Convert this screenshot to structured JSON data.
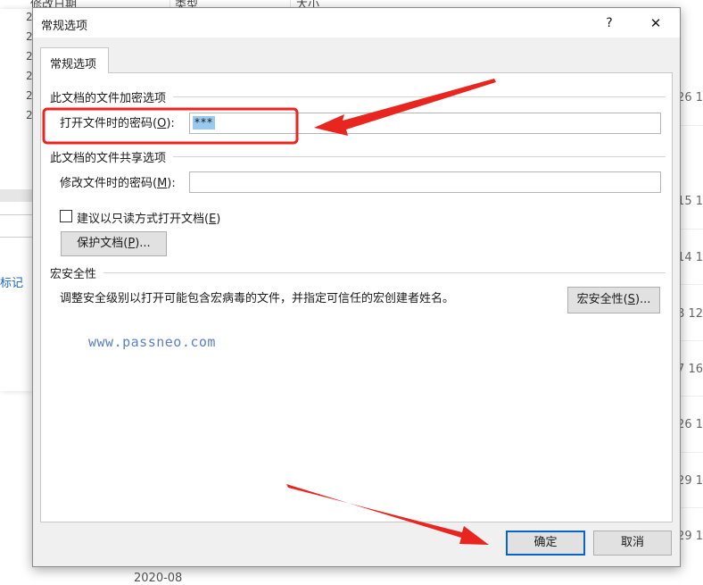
{
  "background": {
    "columns": [
      "修改日期",
      "类型",
      "大小"
    ],
    "side_label": "标记",
    "row_numbers": [
      "2",
      "2",
      "2",
      "2",
      "2",
      "2"
    ],
    "dates": [
      "/26 1",
      "/15 1",
      "/14 1",
      "/8 12",
      "/7 16",
      "/26 1",
      "/29 1",
      "/29 1"
    ],
    "bottom_text": "2020-08"
  },
  "dialog": {
    "title": "常规选项",
    "help_label": "?",
    "close_label": "✕",
    "tab_label": "常规选项",
    "encryption": {
      "section_label": "此文档的文件加密选项",
      "open_password_label": "打开文件时的密码(",
      "open_password_hotkey": "O",
      "open_password_suffix": "):",
      "open_password_value": "***"
    },
    "sharing": {
      "section_label": "此文档的文件共享选项",
      "modify_password_label": "修改文件时的密码(",
      "modify_password_hotkey": "M",
      "modify_password_suffix": "):",
      "modify_password_value": "",
      "readonly_label": "建议以只读方式打开文档(",
      "readonly_hotkey": "E",
      "readonly_suffix": ")",
      "readonly_checked": false,
      "protect_button_label": "保护文档(",
      "protect_button_hotkey": "P",
      "protect_button_suffix": ")..."
    },
    "macro": {
      "section_label": "宏安全性",
      "description": "调整安全级别以打开可能包含宏病毒的文件，并指定可信任的宏创建者姓名。",
      "button_label": "宏安全性(",
      "button_hotkey": "S",
      "button_suffix": ")..."
    },
    "watermark": "www.passneo.com",
    "ok_label": "确定",
    "cancel_label": "取消"
  },
  "colors": {
    "annotation_red": "#e8251f",
    "selection_blue": "#99c9ef",
    "focus_blue": "#0a64c8"
  }
}
